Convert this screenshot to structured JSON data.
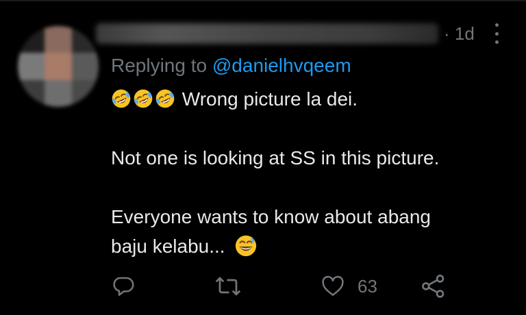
{
  "tweet": {
    "timestamp": "· 1d",
    "replying_prefix": "Replying to ",
    "replying_handle": "@danielhvqeem",
    "line1": "Wrong picture la dei.",
    "line2": "Not one is looking at SS in this picture.",
    "line3": "Everyone wants to know about  abang",
    "line4": "baju kelabu...",
    "like_count": "63"
  },
  "icons": {
    "laughing": "rolling-on-floor-laughing-emoji",
    "sweat_smile": "grinning-face-with-sweat-emoji",
    "reply": "reply-icon",
    "retweet": "retweet-icon",
    "like": "heart-icon",
    "share": "share-icon",
    "more": "more-options-icon"
  },
  "colors": {
    "background": "#000000",
    "text": "#e7e9ea",
    "secondary": "#71767b",
    "link": "#1d9bf0",
    "emoji_yellow": "#f7c325"
  }
}
